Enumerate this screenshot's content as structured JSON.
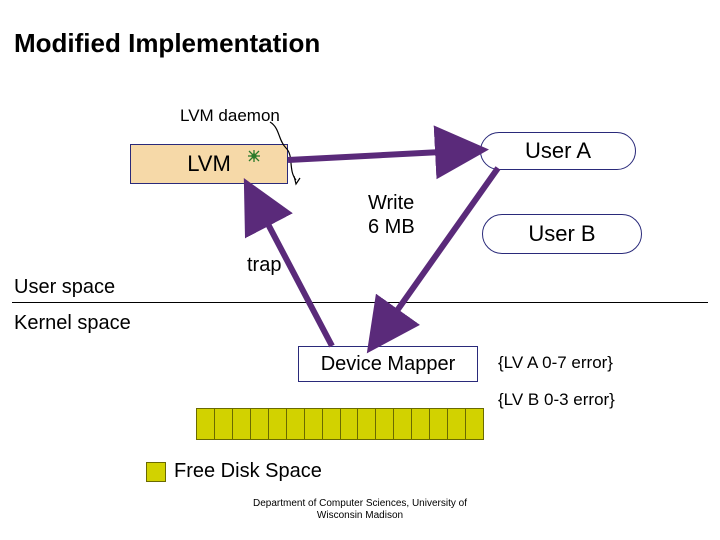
{
  "title": "Modified Implementation",
  "labels": {
    "lvm_daemon": "LVM daemon",
    "lvm": "LVM",
    "user_a": "User A",
    "user_b": "User B",
    "write": "Write\n6 MB",
    "trap": "trap",
    "user_space": "User space",
    "kernel_space": "Kernel space",
    "device_mapper": "Device Mapper",
    "err_a": "{LV A 0-7 error}",
    "err_b": "{LV B 0-3 error}",
    "legend": "Free Disk Space"
  },
  "disk": {
    "cells": 16
  },
  "footer": "Department of Computer Sciences, University of\nWisconsin Madison",
  "colors": {
    "box_border": "#2a2a7a",
    "lvm_fill": "#f6d9a8",
    "disk_fill": "#d2d200",
    "disk_border": "#6a6a00",
    "arrow_purple": "#5a2a7a",
    "marker_green": "#2a7a2a"
  }
}
